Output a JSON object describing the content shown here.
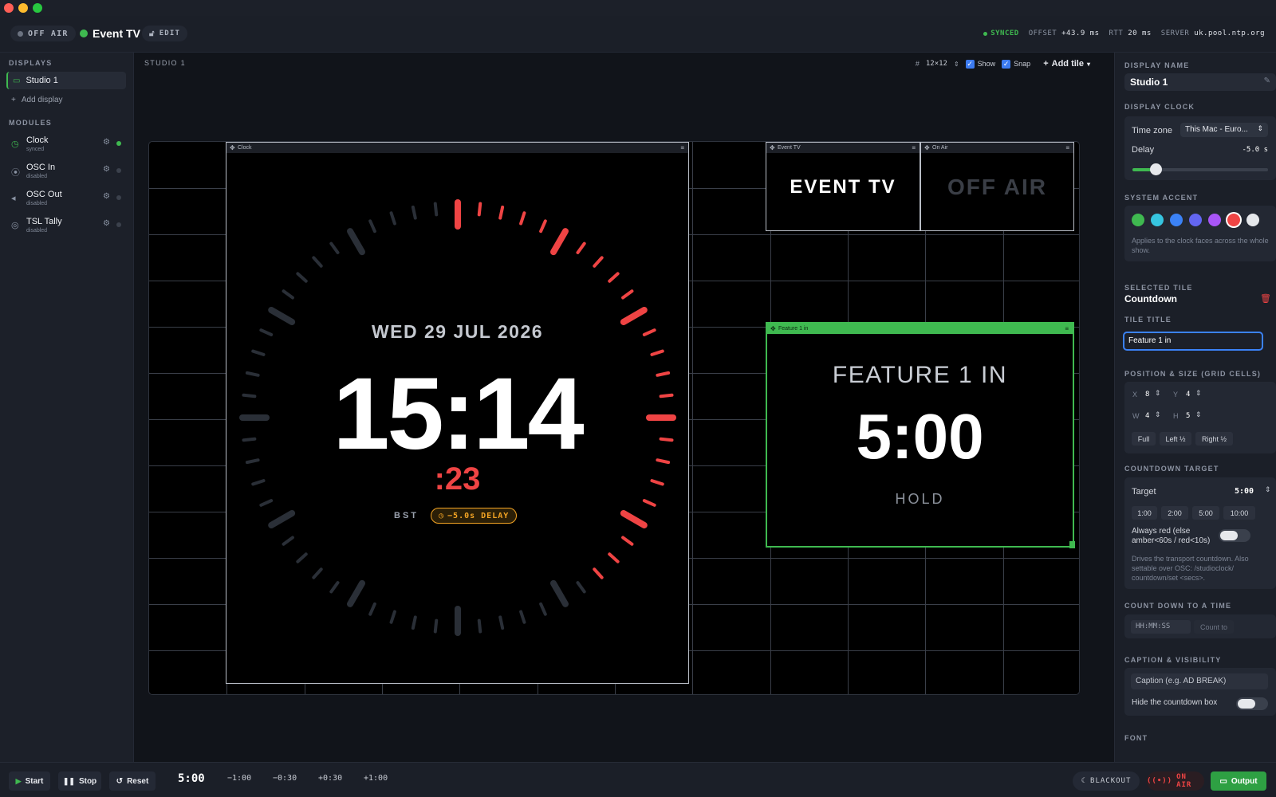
{
  "app": {
    "brand": "Event TV",
    "onair_status": "OFF AIR",
    "edit_label": "EDIT"
  },
  "sync": {
    "status": "SYNCED",
    "offset_label": "OFFSET",
    "offset": "+43.9 ms",
    "rtt_label": "RTT",
    "rtt": "20 ms",
    "server_label": "SERVER",
    "server": "uk.pool.ntp.org"
  },
  "sidebar": {
    "displays_header": "DISPLAYS",
    "displays": [
      {
        "label": "Studio 1",
        "icon": "monitor-icon"
      }
    ],
    "add_display": "Add display",
    "modules_header": "MODULES",
    "modules": [
      {
        "name": "Clock",
        "status": "synced",
        "icon": "clock-icon",
        "active": true
      },
      {
        "name": "OSC In",
        "status": "disabled",
        "icon": "antenna-icon",
        "active": false
      },
      {
        "name": "OSC Out",
        "status": "disabled",
        "icon": "broadcast-icon",
        "active": false
      },
      {
        "name": "TSL Tally",
        "status": "disabled",
        "icon": "target-icon",
        "active": false
      }
    ]
  },
  "canvas": {
    "label": "STUDIO 1",
    "grid_size": "12×12",
    "show_label": "Show",
    "snap_label": "Snap",
    "add_tile": "Add tile",
    "tiles": {
      "clock": {
        "title": "Clock",
        "date": "WED 29 JUL 2026",
        "time": "15:14",
        "seconds": ":23",
        "tz": "BST",
        "delay_badge": "−5.0s DELAY"
      },
      "event": {
        "title": "Event TV",
        "text": "EVENT TV"
      },
      "onair": {
        "title": "On Air",
        "text": "OFF AIR"
      },
      "countdown": {
        "title": "Feature 1 in",
        "heading": "FEATURE 1 IN",
        "value": "5:00",
        "state": "HOLD"
      }
    }
  },
  "panel": {
    "display_name_header": "DISPLAY NAME",
    "display_name": "Studio 1",
    "display_clock_header": "DISPLAY CLOCK",
    "timezone_label": "Time zone",
    "timezone_value": "This Mac - Euro...",
    "delay_label": "Delay",
    "delay_value": "-5.0 s",
    "delay_slider_fraction": 0.15,
    "accent_header": "SYSTEM ACCENT",
    "accents": [
      "#3fb950",
      "#36c5e0",
      "#3b82f6",
      "#6366f1",
      "#a855f7",
      "#ef4444",
      "#e5e7eb"
    ],
    "accent_selected": "#ef4444",
    "accent_note": "Applies to the clock faces across the whole show.",
    "selected_tile_header": "SELECTED TILE",
    "selected_tile": "Countdown",
    "tile_title_header": "TILE TITLE",
    "tile_title_value": "Feature 1 in",
    "position_header": "POSITION & SIZE (GRID CELLS)",
    "pos": {
      "x_label": "X",
      "x": "8",
      "y_label": "Y",
      "y": "4",
      "w_label": "W",
      "w": "4",
      "h_label": "H",
      "h": "5"
    },
    "pos_buttons": [
      "Full",
      "Left ½",
      "Right ½"
    ],
    "countdown_header": "COUNTDOWN TARGET",
    "target_label": "Target",
    "target_value": "5:00",
    "target_presets": [
      "1:00",
      "2:00",
      "5:00",
      "10:00"
    ],
    "always_red_label": "Always red (else amber<60s / red<10s)",
    "countdown_note": "Drives the transport countdown. Also settable over OSC: /studioclock/ countdown/set <secs>.",
    "count_to_header": "COUNT DOWN TO A TIME",
    "count_to_placeholder": "HH:MM:SS",
    "count_to_button": "Count to",
    "caption_header": "CAPTION & VISIBILITY",
    "caption_placeholder": "Caption (e.g. AD BREAK)",
    "hide_box_label": "Hide the countdown box",
    "font_header": "FONT"
  },
  "transport": {
    "start": "Start",
    "stop": "Stop",
    "reset": "Reset",
    "time": "5:00",
    "nudges": [
      "−1:00",
      "−0:30",
      "+0:30",
      "+1:00"
    ],
    "blackout": "BLACKOUT",
    "onair": "ON AIR",
    "output": "Output"
  },
  "colors": {
    "accent_green": "#3fb950",
    "accent_red": "#ef4444",
    "amber": "#f5a524"
  }
}
